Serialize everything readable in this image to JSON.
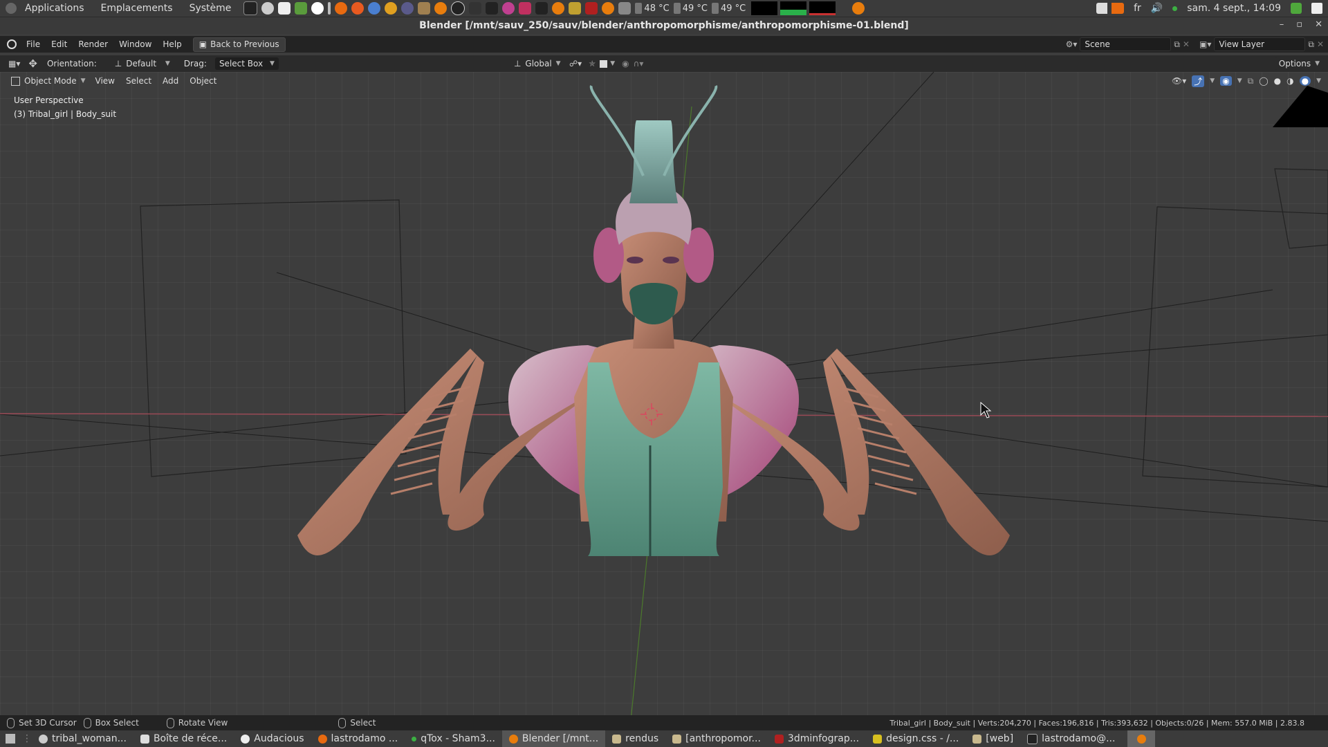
{
  "system_panel": {
    "menus": [
      "Applications",
      "Emplacements",
      "Système"
    ],
    "temps": [
      "48 °C",
      "49 °C",
      "49 °C"
    ],
    "lang": "fr",
    "clock": "sam. 4 sept., 14:09"
  },
  "window": {
    "title": "Blender [/mnt/sauv_250/sauv/blender/anthropomorphisme/anthropomorphisme-01.blend]"
  },
  "topbar": {
    "menus": [
      "File",
      "Edit",
      "Render",
      "Window",
      "Help"
    ],
    "back_label": "Back to Previous",
    "scene": "Scene",
    "view_layer": "View Layer"
  },
  "toolheader": {
    "orientation_label": "Orientation:",
    "orientation_value": "Default",
    "drag_label": "Drag:",
    "drag_value": "Select Box",
    "transform_value": "Global",
    "options_label": "Options"
  },
  "viewport_header": {
    "mode": "Object Mode",
    "menus": [
      "View",
      "Select",
      "Add",
      "Object"
    ]
  },
  "viewport": {
    "perspective": "User Perspective",
    "active_object": "(3) Tribal_girl | Body_suit"
  },
  "statusbar": {
    "set_cursor": "Set 3D Cursor",
    "box_select": "Box Select",
    "rotate_view": "Rotate View",
    "select": "Select",
    "stats": "Tribal_girl | Body_suit | Verts:204,270 | Faces:196,816 | Tris:393,632 | Objects:0/26 | Mem: 557.0 MiB | 2.83.8"
  },
  "taskbar": {
    "tasks": [
      "tribal_woman...",
      "Boîte de réce...",
      "Audacious",
      "lastrodamo ...",
      "qTox - Sham3...",
      "Blender [/mnt...",
      "rendus",
      "[anthropomor...",
      "3dminfograp...",
      "design.css - /...",
      "[web]",
      "lastrodamo@..."
    ]
  },
  "colors": {
    "accent": "#4772b3",
    "blender_orange": "#e87d0d",
    "x_axis": "#d9475e",
    "y_axis": "#6fa83c"
  }
}
